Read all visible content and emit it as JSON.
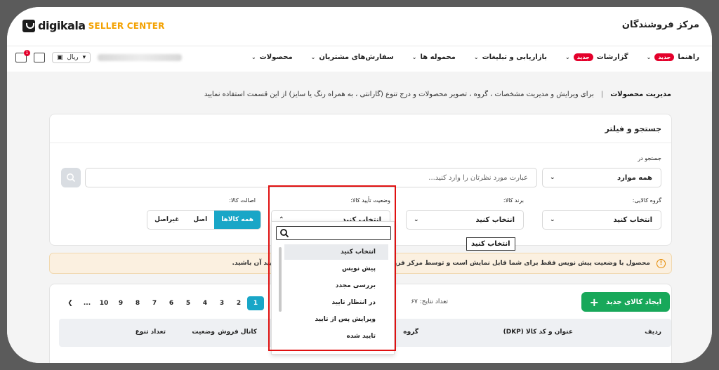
{
  "header": {
    "logo_text": "digikala",
    "logo_sub": "SELLER CENTER",
    "app_title": "مرکز فروشندگان"
  },
  "nav": {
    "items": [
      {
        "label": "محصولات"
      },
      {
        "label": "سفارش‌های مشتریان"
      },
      {
        "label": "محموله ها"
      },
      {
        "label": "بازاریابی و تبلیغات"
      },
      {
        "label": "گزارشات",
        "badge": "جدید"
      },
      {
        "label": "راهنما",
        "badge": "جدید"
      }
    ],
    "currency_label": "ریال",
    "notification_count": "1"
  },
  "breadcrumb": {
    "title": "مدیریت محصولات",
    "description": "برای ویرایش و مدیریت مشخصات ، گروه ، تصویر محصولات و درج تنوع (گارانتی ، به همراه رنگ یا سایز) از این قسمت استفاده نمایید"
  },
  "filter": {
    "title": "جستجو و فیلتر",
    "search_in_label": "جستجو در",
    "search_in_value": "همه موارد",
    "search_placeholder": "عبارت مورد نظرتان را وارد کنید...",
    "group_label": "گروه کالایی:",
    "group_value": "انتخاب کنید",
    "brand_label": "برند کالا:",
    "brand_value": "انتخاب کنید",
    "status_label": "وضعیت تأیید کالا:",
    "status_value": "انتخاب کنید",
    "originality_label": "اصالت کالا:",
    "originality_options": [
      "همه کالاها",
      "اصل",
      "غیراصل"
    ]
  },
  "alert": {
    "text": "محصول با وضعیت پیش نویس فقط برای شما قابل نمایش است و توسط مرکز فروشندگان قابل ... انتشار داده و منتظر تأیید آن باشید."
  },
  "list": {
    "add_button": "ایجاد کالای جدید",
    "results_label": "تعداد نتایج:",
    "results_value": "۶۷",
    "pages": [
      "1",
      "2",
      "3",
      "4",
      "5",
      "6",
      "7",
      "8",
      "9",
      "10",
      "..."
    ],
    "active_page": "1",
    "columns": [
      "ردیف",
      "عنوان و کد کالا (DKP)",
      "گروه",
      "کانال فروش",
      "وضعیت",
      "تعداد تنوع"
    ]
  },
  "status_dropdown": {
    "options": [
      "انتخاب کنید",
      "پیش نویس",
      "بررسی مجدد",
      "در انتظار تایید",
      "ویرایش پس از تایید",
      "تایید شده"
    ],
    "highlighted": "انتخاب کنید",
    "tooltip": "انتخاب کنید"
  },
  "colors": {
    "accent": "#19a6c7",
    "primary_green": "#18a85a",
    "badge_red": "#e4002b",
    "brand_orange": "#f3a100",
    "highlight_box": "#e01010"
  }
}
